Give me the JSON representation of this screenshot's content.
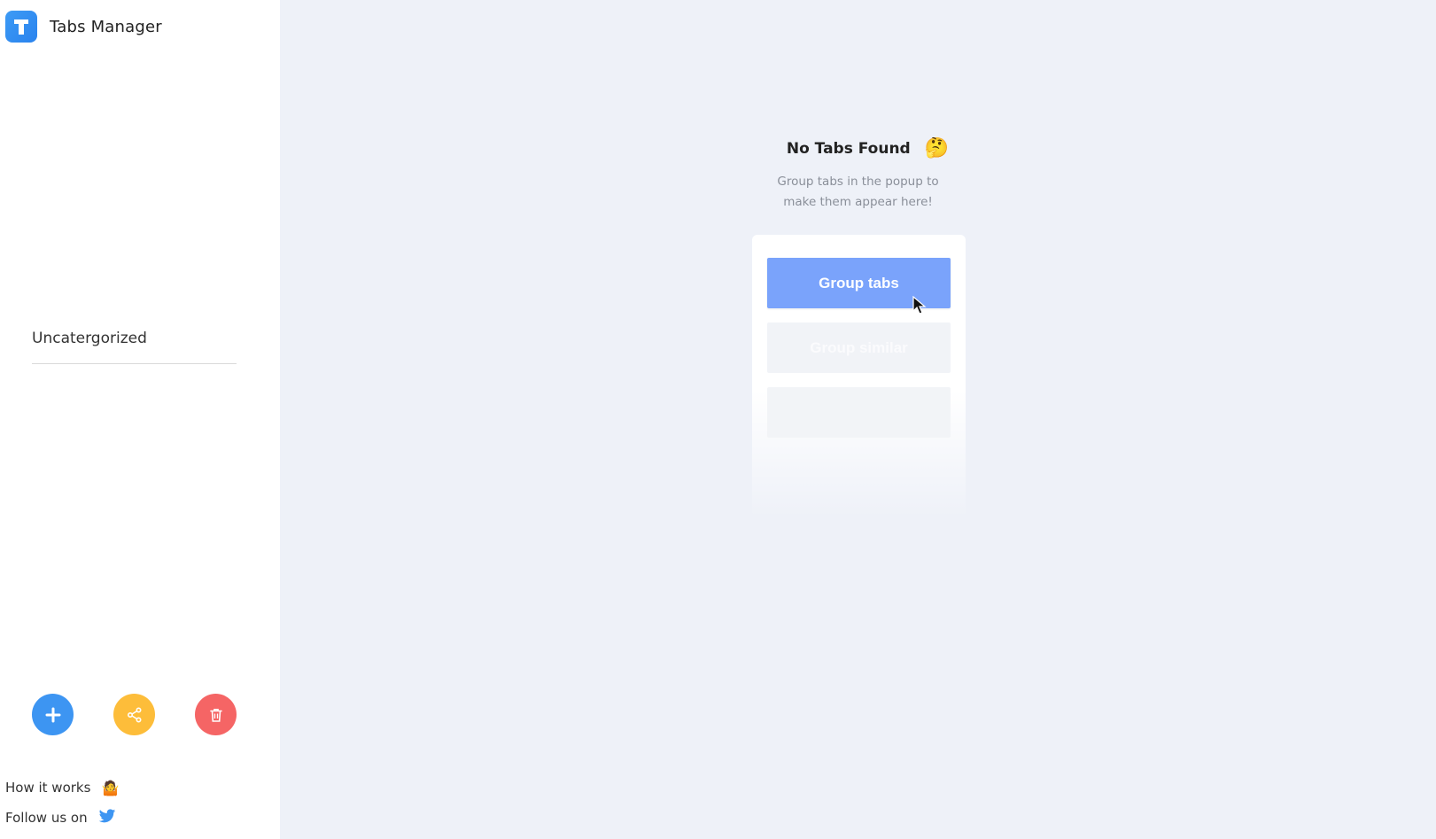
{
  "app": {
    "title": "Tabs Manager",
    "logo_letter": "T",
    "brand_color": "#3d95f2"
  },
  "sidebar": {
    "categories": [
      {
        "label": "Uncatergorized"
      }
    ],
    "actions": {
      "add_icon": "plus-icon",
      "add_color": "#3d95f2",
      "share_icon": "share-icon",
      "share_color": "#fdbd3a",
      "delete_icon": "trash-icon",
      "delete_color": "#f56565"
    },
    "footer": {
      "how_it_works": "How it works",
      "how_it_works_emoji": "🤷",
      "follow_us": "Follow us on",
      "follow_icon": "twitter-icon"
    }
  },
  "main": {
    "empty_state": {
      "title": "No Tabs Found",
      "emoji": "🤔",
      "description": "Group tabs in the popup to make them appear here!"
    },
    "demo": {
      "primary_button": "Group tabs",
      "secondary_button": "Group similar",
      "third_button": ""
    }
  }
}
